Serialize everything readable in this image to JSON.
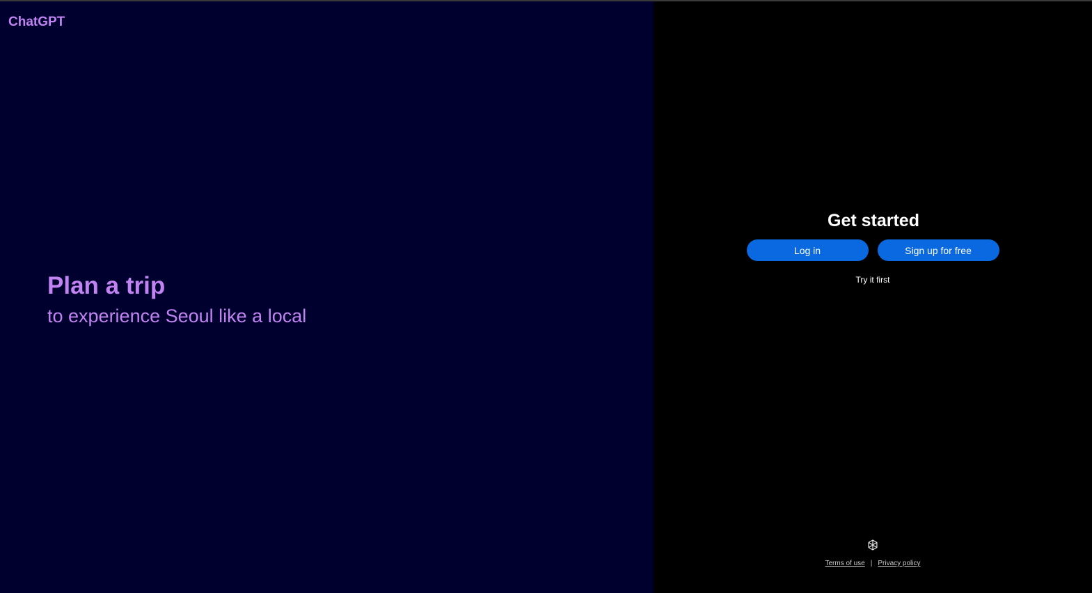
{
  "brand": {
    "name": "ChatGPT"
  },
  "hero": {
    "title": "Plan a trip",
    "subtitle": "to experience Seoul like a local"
  },
  "auth": {
    "title": "Get started",
    "login_label": "Log in",
    "signup_label": "Sign up for free",
    "try_label": "Try it first"
  },
  "footer": {
    "logo_icon": "openai-logo-icon",
    "terms_label": "Terms of use",
    "separator": "|",
    "privacy_label": "Privacy policy"
  },
  "colors": {
    "left_background": "#00002e",
    "right_background": "#000000",
    "accent_purple": "#c182f2",
    "button_blue": "#0a69e1"
  }
}
